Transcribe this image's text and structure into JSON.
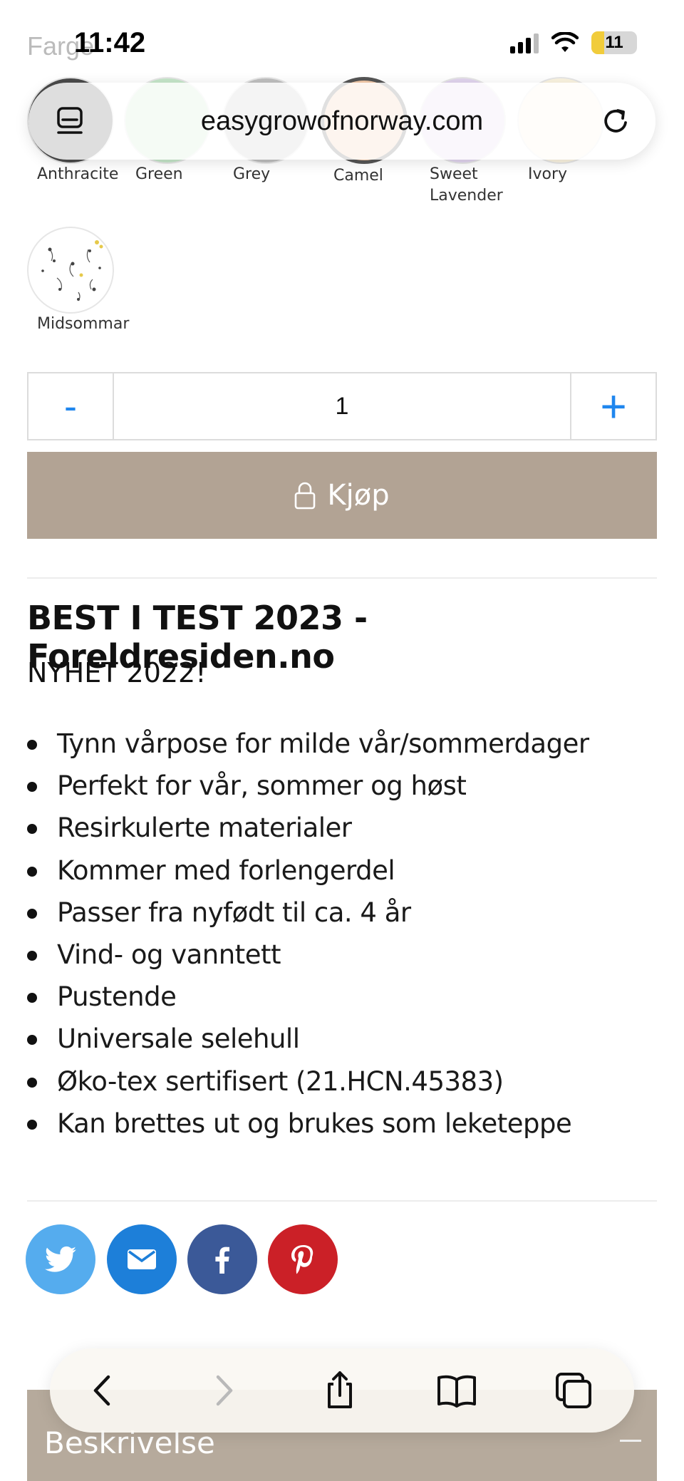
{
  "status_bar": {
    "time": "11:42",
    "battery": "11"
  },
  "browser": {
    "url": "easygrowofnorway.com"
  },
  "color_section": {
    "label": "Farge",
    "swatches": [
      {
        "name": "Anthracite",
        "color": "#4a4a4a"
      },
      {
        "name": "Green",
        "color": "#c5e6c9"
      },
      {
        "name": "Grey",
        "color": "#bfbfbf"
      },
      {
        "name": "Camel",
        "color": "#f3c9a8",
        "selected": true
      },
      {
        "name": "Sweet Lavender",
        "color": "#e1d4ee"
      },
      {
        "name": "Ivory",
        "color": "#fbf4e0"
      }
    ],
    "extra_swatch": {
      "name": "Midsommar"
    }
  },
  "quantity": {
    "minus": "-",
    "value": "1",
    "plus": "+"
  },
  "buy_button": {
    "label": "Kjøp"
  },
  "product": {
    "heading": "BEST I TEST 2023 - Foreldresiden.no",
    "subheading": "NYHET 2022!",
    "features": [
      "Tynn vårpose for milde vår/sommerdager",
      "Perfekt for vår, sommer og høst",
      "Resirkulerte materialer",
      "Kommer med forlengerdel",
      "Passer fra nyfødt til ca. 4 år",
      "Vind- og vanntett",
      "Pustende",
      "Universale selehull",
      "Øko-tex sertifisert (21.HCN.45383)",
      "Kan brettes ut og brukes som leketeppe"
    ]
  },
  "share": {
    "buttons": [
      {
        "icon": "twitter-icon",
        "color": "#55acee"
      },
      {
        "icon": "mail-icon",
        "color": "#1d7fd9"
      },
      {
        "icon": "facebook-icon",
        "color": "#3b5998"
      },
      {
        "icon": "pinterest-icon",
        "color": "#cb2027"
      }
    ]
  },
  "accordion": {
    "title": "Beskrivelse"
  },
  "toolbar": {
    "icons": [
      "back-icon",
      "forward-icon",
      "share-icon",
      "bookmarks-icon",
      "tabs-icon"
    ]
  }
}
